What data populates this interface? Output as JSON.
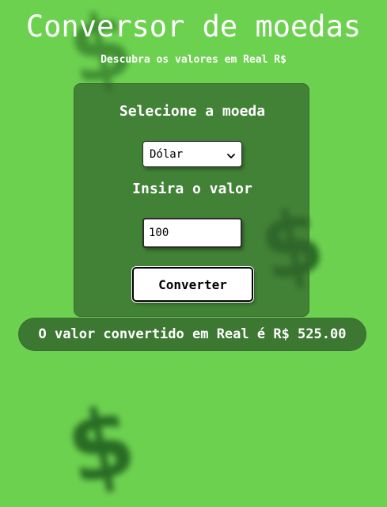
{
  "header": {
    "title": "Conversor de moedas",
    "subtitle": "Descubra os valores em Real R$"
  },
  "background": {
    "icon": "dollar-sign-icon",
    "glyph": "$"
  },
  "form": {
    "currency_label": "Selecione a moeda",
    "currency_selected": "Dólar",
    "value_label": "Insira o valor",
    "value_input": "100",
    "convert_button": "Converter"
  },
  "result": {
    "text": "O valor convertido em Real é R$ 525.00"
  },
  "colors": {
    "background": "#6dd150",
    "card": "#32642d",
    "text": "#ffffff"
  }
}
